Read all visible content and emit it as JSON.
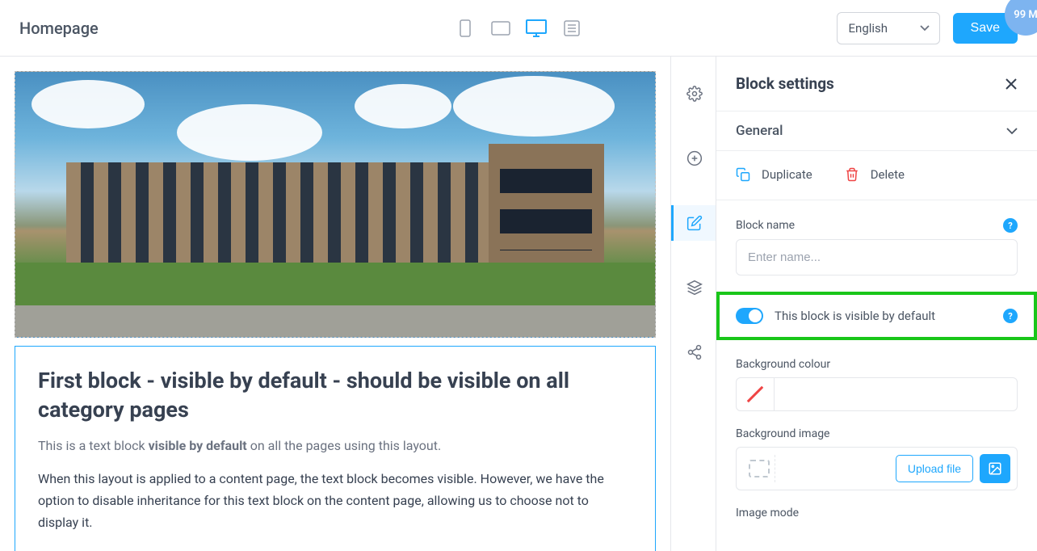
{
  "header": {
    "title": "Homepage",
    "language_selected": "English",
    "save_label": "Save",
    "badge": "99 M"
  },
  "viewport": {
    "mobile": "mobile",
    "tablet": "tablet",
    "desktop": "desktop",
    "menu": "menu",
    "active": "desktop"
  },
  "canvas": {
    "block_heading": "First block - visible by default - should be visible on all category pages",
    "block_sub_prefix": "This is a text block ",
    "block_sub_bold": "visible by default",
    "block_sub_suffix": " on all the pages using this layout.",
    "block_body": "When this layout is applied to a content page, the text block becomes visible. However, we have the option to disable inheritance for this text block on the content page, allowing us to choose not to display it."
  },
  "rail": {
    "settings": "settings-icon",
    "add": "add-icon",
    "edit": "edit-icon",
    "layers": "layers-icon",
    "share": "share-icon"
  },
  "panel": {
    "title": "Block settings",
    "section_general": "General",
    "duplicate": "Duplicate",
    "delete": "Delete",
    "block_name_label": "Block name",
    "block_name_placeholder": "Enter name...",
    "visibility_label": "This block is visible by default",
    "bg_colour_label": "Background colour",
    "bg_image_label": "Background image",
    "upload_file": "Upload file",
    "image_mode_label": "Image mode",
    "help": "?"
  }
}
